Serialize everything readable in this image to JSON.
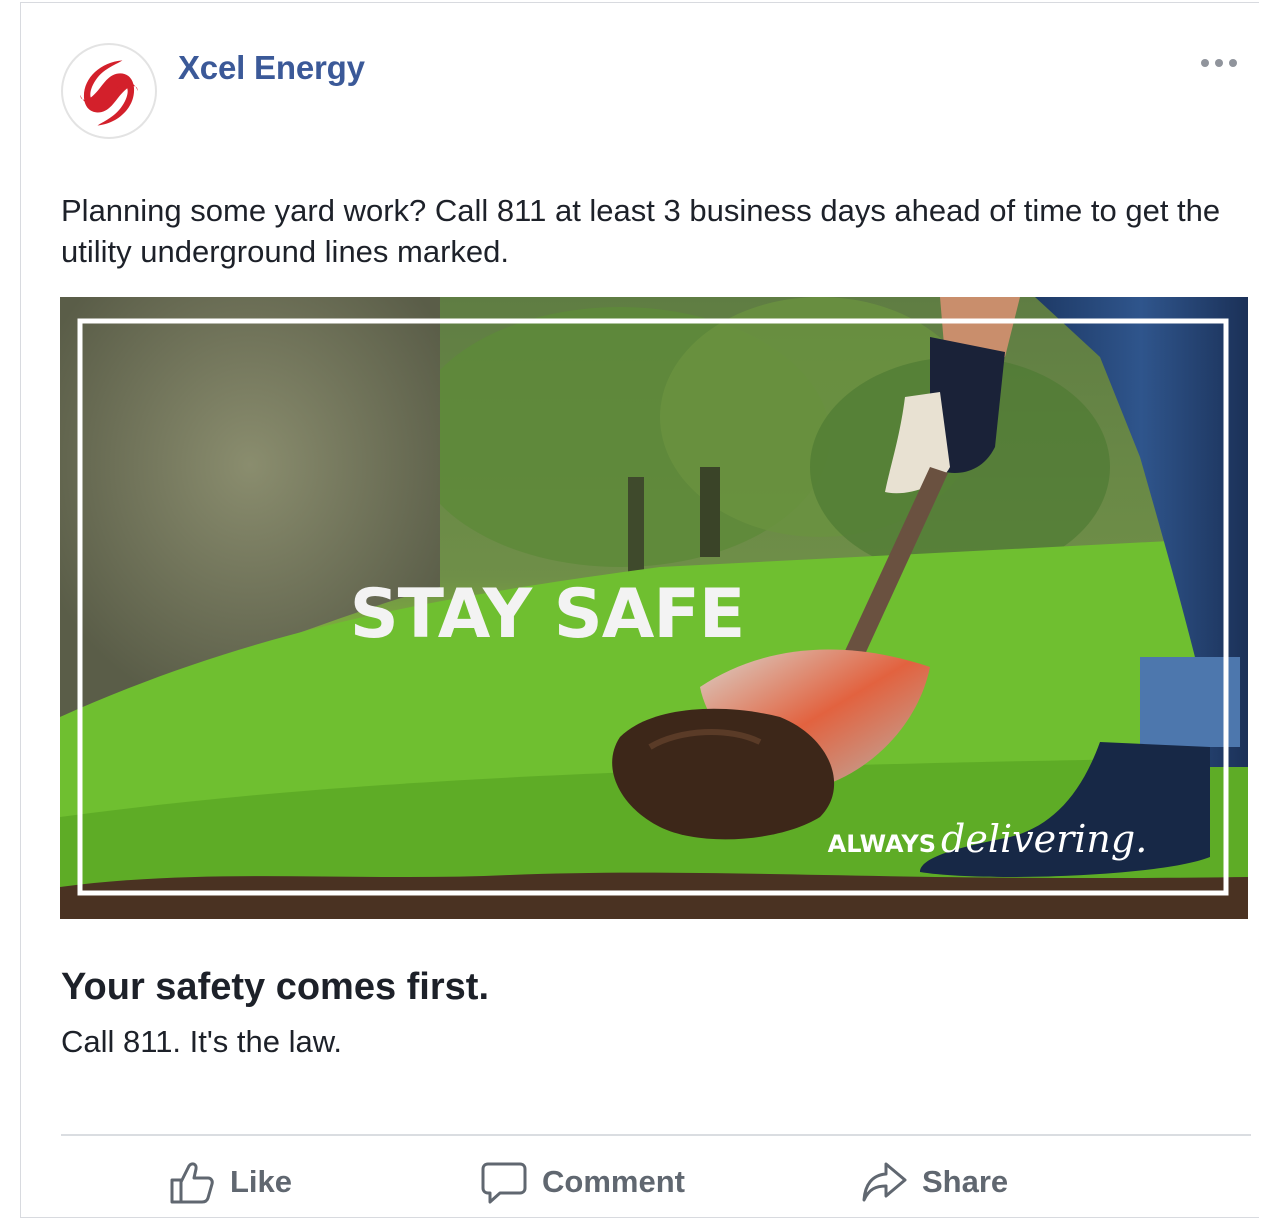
{
  "post": {
    "page_name": "Xcel Energy",
    "body_text": "Planning some yard work? Call 811 at least 3 business days ahead of time to get the utility underground lines marked.",
    "image": {
      "headline": "STAY SAFE",
      "tagline_prefix": "ALWAYS",
      "tagline_script": "delivering."
    },
    "link_title": "Your safety comes first.",
    "link_description": "Call 811. It's the law.",
    "icons": {
      "avatar": "xcel-logo-icon",
      "more": "more-options-icon",
      "like": "thumbs-up-icon",
      "comment": "speech-bubble-icon",
      "share": "share-arrow-icon"
    }
  },
  "actions": {
    "like_label": "Like",
    "comment_label": "Comment",
    "share_label": "Share"
  },
  "colors": {
    "brand_blue": "#3b5998",
    "logo_red": "#d3202b",
    "action_gray": "#606770",
    "text": "#1d2129"
  }
}
